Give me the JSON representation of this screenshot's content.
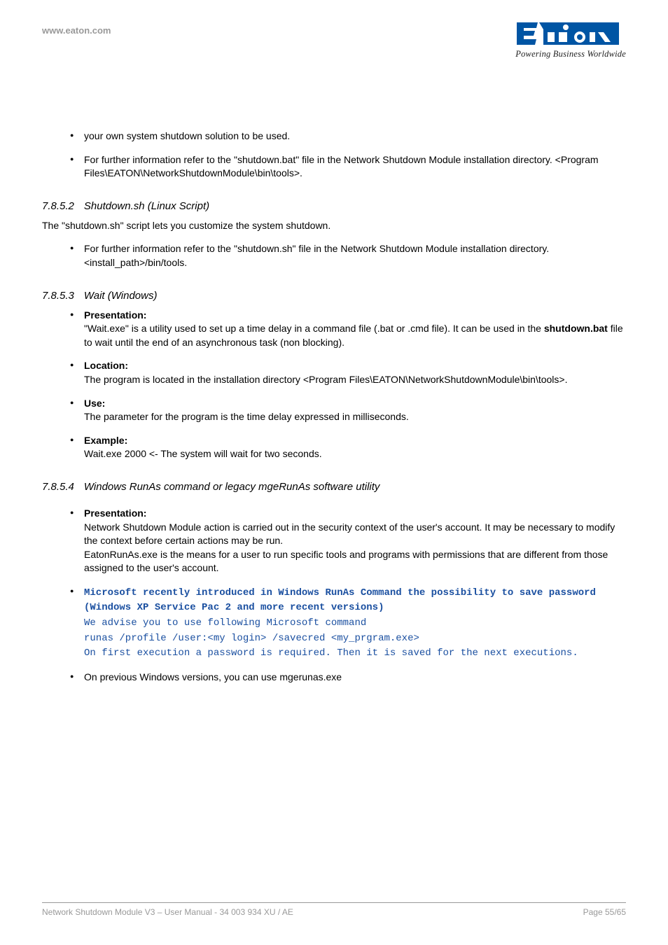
{
  "header": {
    "url": "www.eaton.com",
    "tagline": "Powering Business Worldwide"
  },
  "bullets_top": [
    "your own system shutdown solution to be used.",
    "For further information refer to the \"shutdown.bat\" file in the Network Shutdown Module installation directory. <Program Files\\EATON\\NetworkShutdownModule\\bin\\tools>."
  ],
  "sec2": {
    "num": "7.8.5.2",
    "title": "Shutdown.sh (Linux Script)",
    "intro": "The \"shutdown.sh\" script lets you customize the system shutdown.",
    "bullets": [
      "For further information refer to the \"shutdown.sh\" file in the Network Shutdown Module installation directory. <install_path>/bin/tools."
    ]
  },
  "sec3": {
    "num": "7.8.5.3",
    "title": "Wait (Windows)",
    "items": [
      {
        "label": "Presentation:",
        "body_pre": "\"Wait.exe\" is a utility used to set up a time delay in a command file (.bat or .cmd file). It can be used in the ",
        "body_bold": "shutdown.bat",
        "body_post": " file to wait until the end of an asynchronous task (non blocking)."
      },
      {
        "label": "Location:",
        "text": "The program is located in the installation directory <Program Files\\EATON\\NetworkShutdownModule\\bin\\tools>."
      },
      {
        "label": "Use:",
        "text": "The parameter for the program is the time delay expressed in milliseconds."
      },
      {
        "label": "Example:",
        "text": "Wait.exe 2000 <- The system will wait for two seconds."
      }
    ]
  },
  "sec4": {
    "num": "7.8.5.4",
    "title": "Windows RunAs command or legacy mgeRunAs  software utility",
    "presentation_label": "Presentation:",
    "presentation_text": "Network Shutdown Module action is carried out in the security context of the user's account. It may be necessary to modify the context before certain actions may be run.\nEatonRunAs.exe is the means for a user to run specific tools and programs with permissions that are different from those assigned to the user's account.",
    "mono_bold": "Microsoft recently introduced in Windows RunAs Command the possibility to save password (Windows XP Service Pac 2 and more recent versions)",
    "mono_lines": [
      "We advise you to use following Microsoft command",
      "runas /profile /user:<my login> /savecred <my_prgram.exe>",
      "On first execution a password is required. Then it is saved for the next executions."
    ],
    "last_bullet": "On previous Windows versions, you can use mgerunas.exe"
  },
  "footer": {
    "left": "Network Shutdown Module V3 – User Manual - 34 003 934 XU / AE",
    "right": "Page 55/65"
  }
}
